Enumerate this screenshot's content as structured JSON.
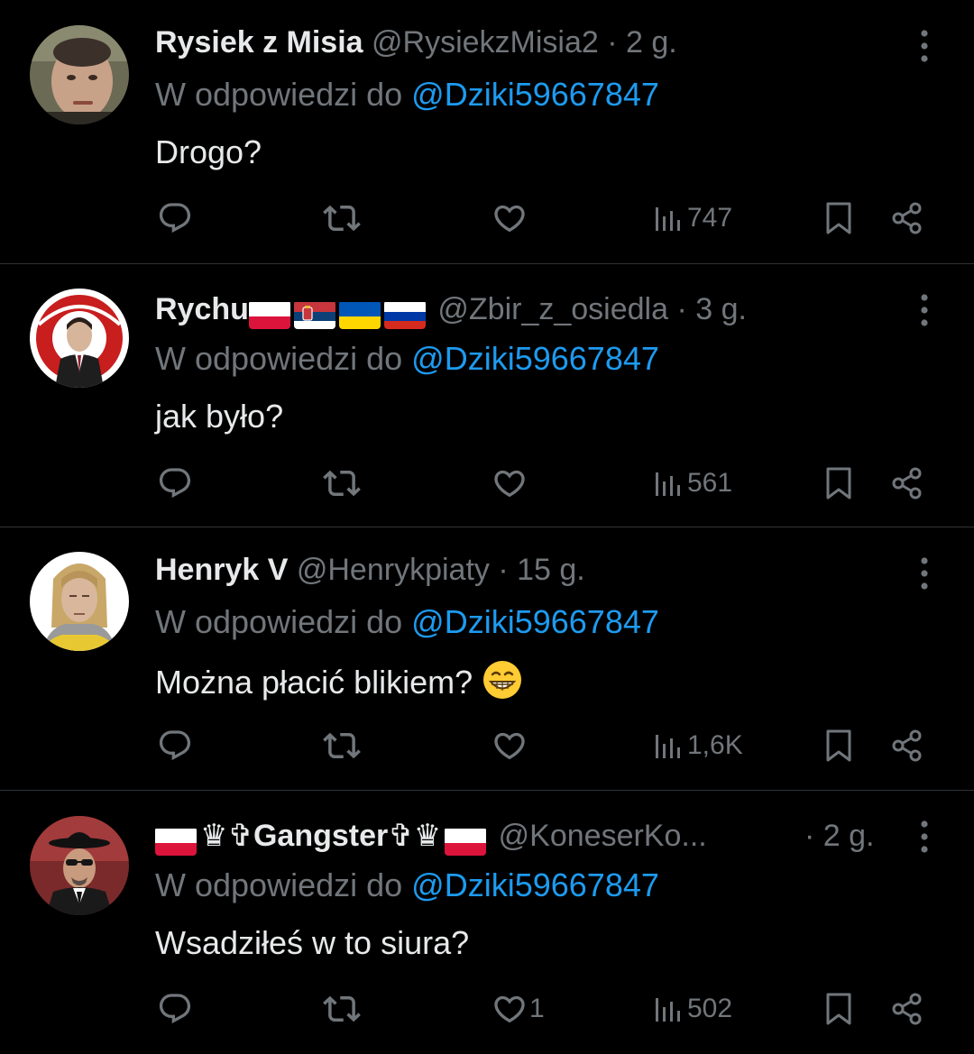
{
  "colors": {
    "background": "#000000",
    "text": "#e7e9ea",
    "muted": "#71767b",
    "accent": "#1d9bf0",
    "divider": "#2f3336"
  },
  "reply_prefix": "W odpowiedzi do",
  "icons": {
    "reply": "speech-bubble-icon",
    "repost": "repost-arrows-icon",
    "like": "heart-icon",
    "views": "bar-chart-icon",
    "bookmark": "bookmark-icon",
    "share": "share-icon",
    "more": "vertical-ellipsis-icon"
  },
  "tweets": [
    {
      "name": "Rysiek z Misia",
      "flags_before": [],
      "flags_after": [],
      "handle": "@RysiekzMisia2",
      "dot": "·",
      "time": "2 g.",
      "reply_to": "@Dziki59667847",
      "text": "Drogo?",
      "likes": "",
      "views": "747"
    },
    {
      "name": "Rychu",
      "flags_before": [],
      "flags_after": [
        "poland-flag",
        "serbia-flag",
        "ukraine-flag",
        "russia-flag"
      ],
      "handle": "@Zbir_z_osiedla",
      "dot": "·",
      "time": "3 g.",
      "reply_to": "@Dziki59667847",
      "text": "jak było?",
      "likes": "",
      "views": "561"
    },
    {
      "name": "Henryk V",
      "flags_before": [],
      "flags_after": [],
      "handle": "@Henrykpiaty",
      "dot": "·",
      "time": "15 g.",
      "reply_to": "@Dziki59667847",
      "text": "Można płacić blikiem?",
      "emoji": "😁",
      "likes": "",
      "views": "1,6K"
    },
    {
      "name": "♛✞Gangster✞♛",
      "flags_before": [
        "poland-flag"
      ],
      "flags_after": [
        "poland-flag"
      ],
      "handle": "@KoneserKo...",
      "dot": "·",
      "time": "2 g.",
      "reply_to": "@Dziki59667847",
      "text": "Wsadziłeś w to siura?",
      "likes": "1",
      "views": "502"
    }
  ]
}
